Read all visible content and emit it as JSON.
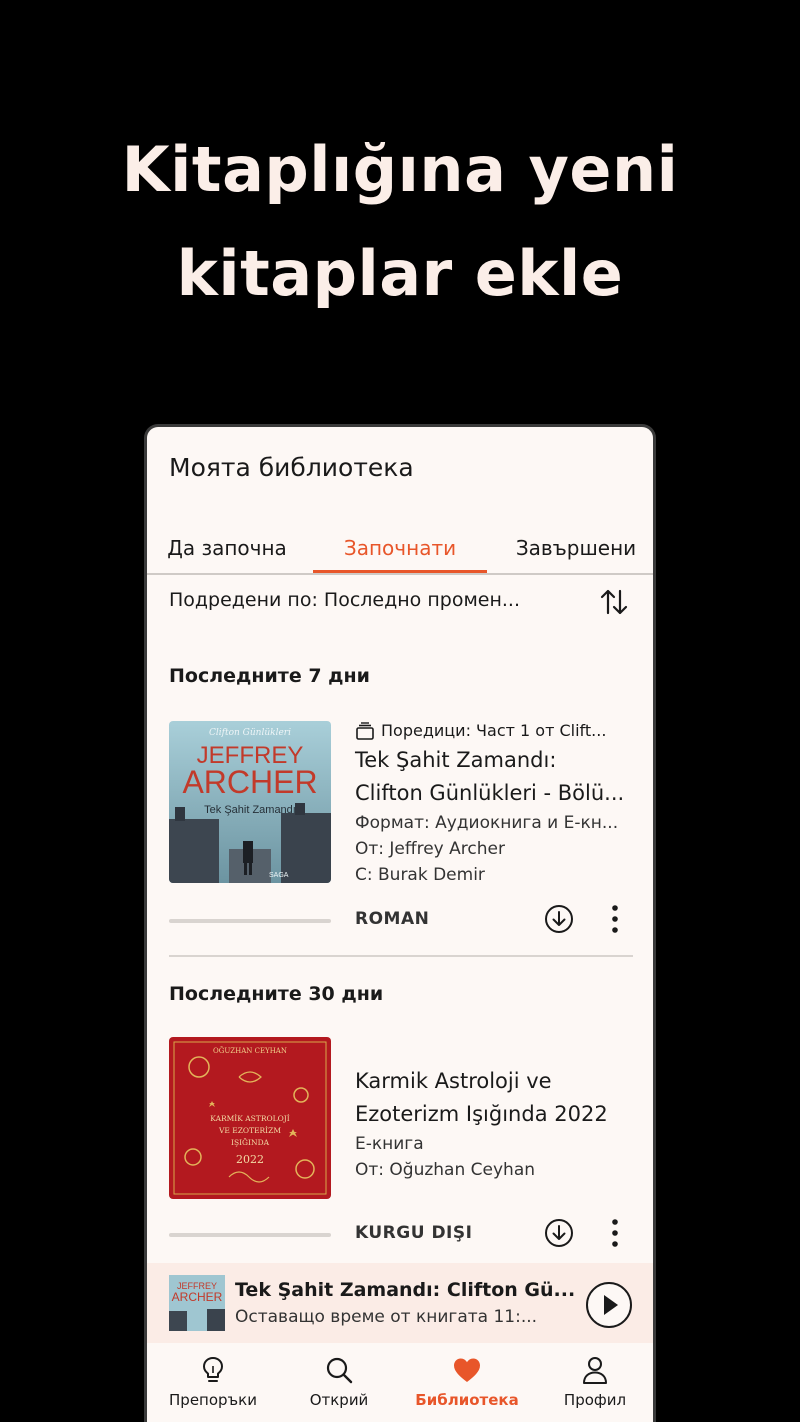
{
  "headline": [
    "Kitaplığına yeni",
    "kitaplar ekle"
  ],
  "app": {
    "title": "Моята библиотека",
    "tabs": [
      {
        "label": "Да започна",
        "active": false
      },
      {
        "label": "Започнати",
        "active": true
      },
      {
        "label": "Завършени",
        "active": false
      }
    ],
    "sort_label": "Подредени по: Последно промен...",
    "accent_color": "#e8562a"
  },
  "sections": [
    {
      "heading": "Последните 7 дни",
      "book": {
        "series": "Поредици: Част 1 от Clift...",
        "title_line1": "Tek Şahit Zamandı:",
        "title_line2": "Clifton Günlükleri - Bölü...",
        "format": "Формат: Аудиокнига и Е-кн...",
        "author": "От: Jeffrey Archer",
        "narrator": "С: Burak Demir",
        "genre": "ROMAN",
        "progress": 0.0,
        "cover": {
          "top": "Clifton Günlükleri",
          "author1": "JEFFREY",
          "author2": "ARCHER",
          "title": "Tek Şahit Zamandı",
          "publisher": "SAGA"
        }
      }
    },
    {
      "heading": "Последните 30 дни",
      "book": {
        "title_line1": "Karmik Astroloji ve",
        "title_line2": "Ezoterizm Işığında 2022",
        "format": "Е-книга",
        "author": "От: Oğuzhan Ceyhan",
        "genre": "KURGU DIŞI",
        "progress": 0.0,
        "cover": {
          "top": "OĞUZHAN CEYHAN",
          "title": "KARMİK ASTROLOJİ VE EZOTERİZM IŞIĞINDA",
          "year": "2022"
        }
      }
    }
  ],
  "player": {
    "title": "Tek Şahit Zamandı: Clifton Gü...",
    "subtitle": "Оставащо време от книгата 11:..."
  },
  "nav": [
    {
      "label": "Препоръки",
      "icon": "lightbulb-icon",
      "active": false
    },
    {
      "label": "Открий",
      "icon": "search-icon",
      "active": false
    },
    {
      "label": "Библиотека",
      "icon": "heart-icon",
      "active": true
    },
    {
      "label": "Профил",
      "icon": "profile-icon",
      "active": false
    }
  ]
}
